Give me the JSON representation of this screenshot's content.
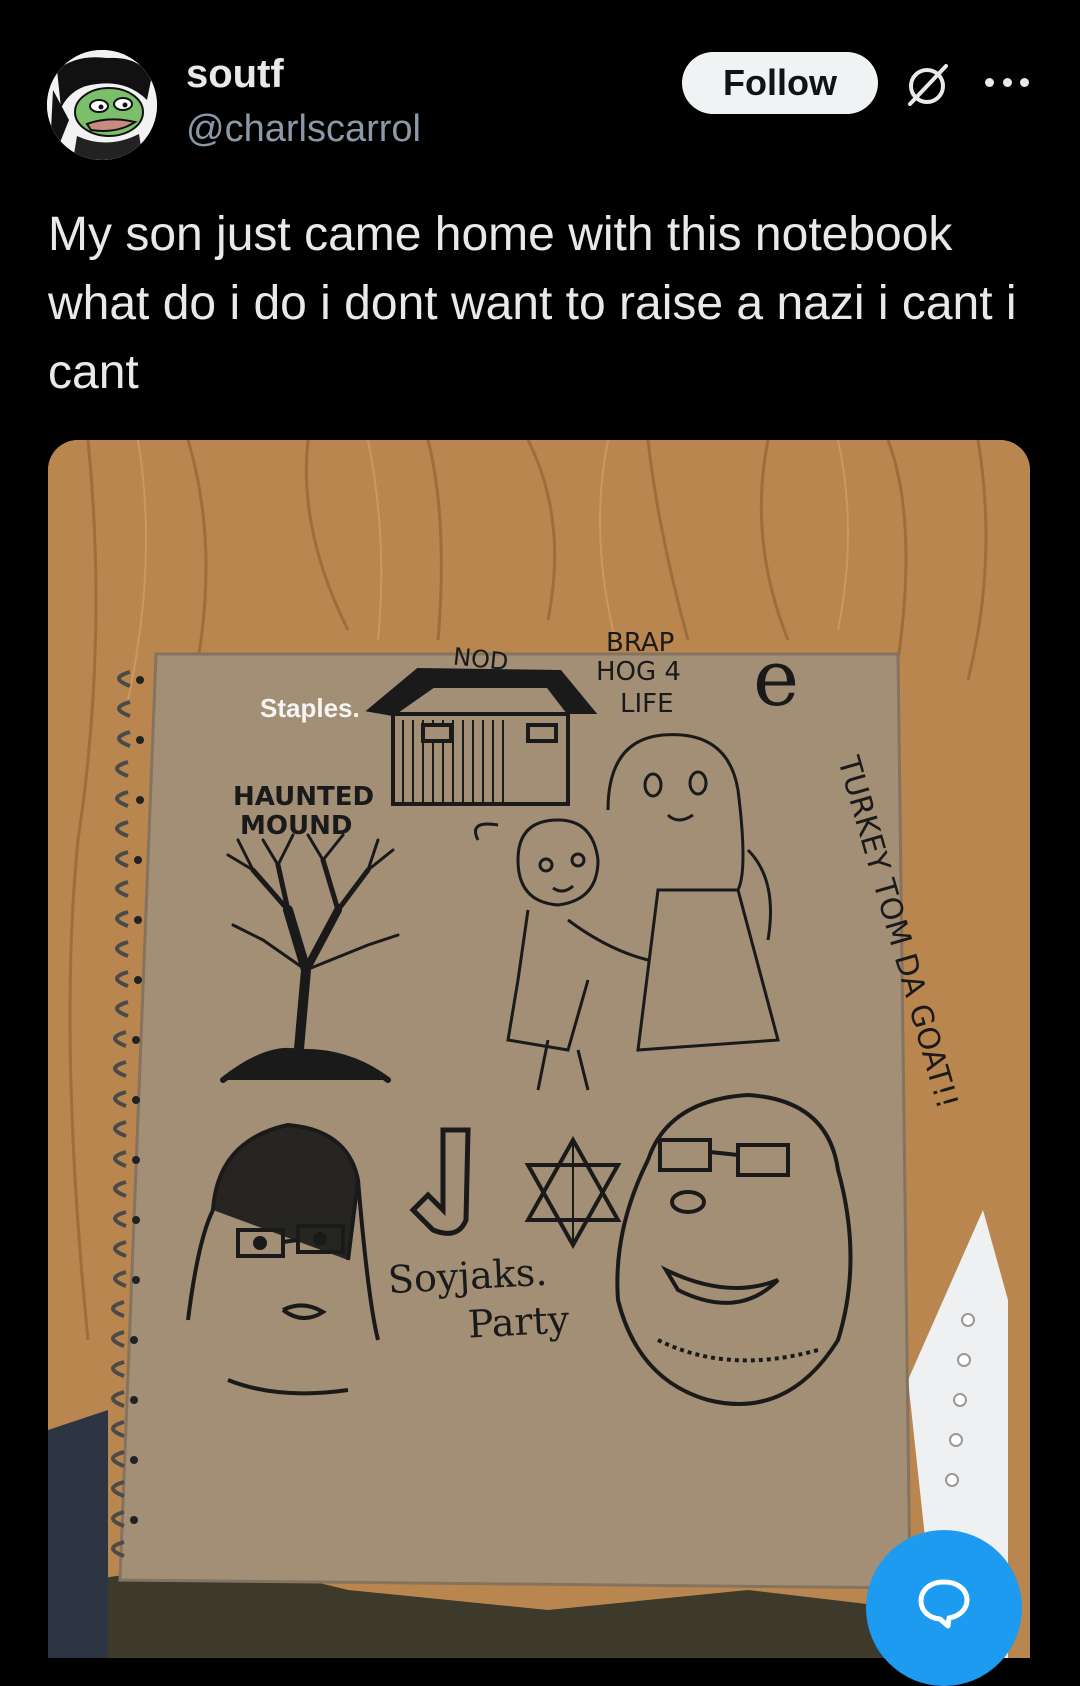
{
  "user": {
    "display_name": "soutf",
    "handle": "@charlscarrol",
    "avatar_icon": "pepe-avatar-icon"
  },
  "actions": {
    "follow_label": "Follow",
    "grok_icon": "grok-icon",
    "more_icon": "more-options-icon"
  },
  "tweet": {
    "text": "My son just came home with this notebook what do i do i dont want to raise a nazi i cant i cant"
  },
  "media": {
    "notebook_brand": "Staples.",
    "doodle_labels": {
      "shed": "NOD",
      "brap_line1": "BRAP",
      "brap_line2": "HOG 4",
      "brap_line3": "LIFE",
      "letter_e": "e",
      "haunted_line1": "HAUNTED",
      "haunted_line2": "MOUND",
      "turkey": "TURKEY TOM DA GOAT!!",
      "soyjaks_line1": "Soyjaks.",
      "soyjaks_line2": "Party"
    }
  },
  "fab": {
    "icon": "reply-bubble-icon"
  },
  "colors": {
    "background": "#000000",
    "text_primary": "#e7e9ea",
    "text_secondary": "#8b98a5",
    "follow_bg": "#eff3f4",
    "accent": "#1d9bf0"
  }
}
